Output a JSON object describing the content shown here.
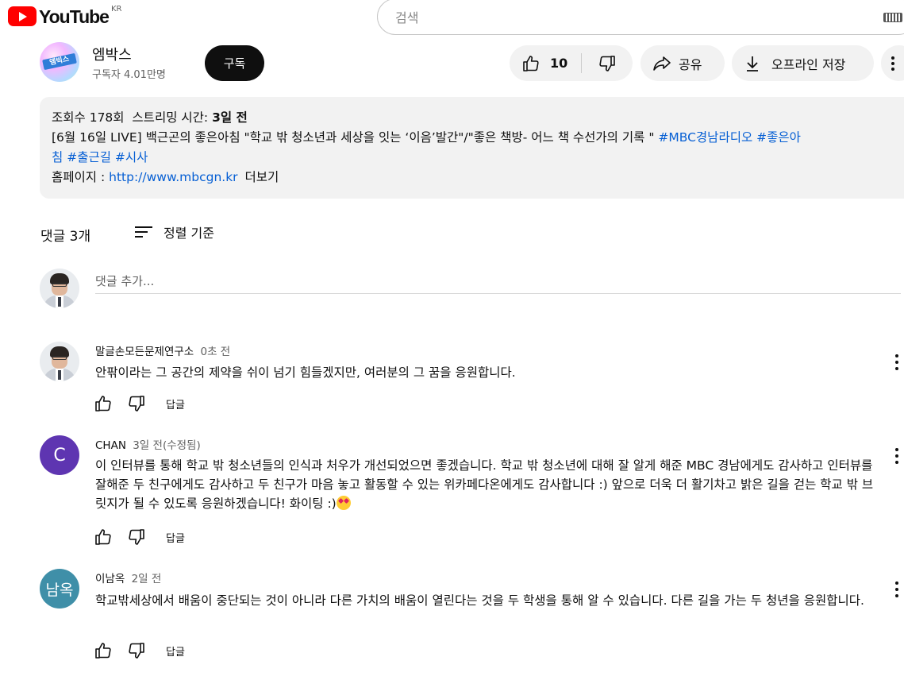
{
  "header": {
    "logo_text": "YouTube",
    "country_code": "KR",
    "search_placeholder": "검색"
  },
  "channel": {
    "avatar_text": "엠빅스",
    "name": "엠박스",
    "subscribers": "구독자 4.01만명",
    "subscribe_label": "구독"
  },
  "actions": {
    "like_count": "10",
    "share_label": "공유",
    "download_label": "오프라인 저장"
  },
  "description": {
    "views": "조회수 178회",
    "streaming_label": "스트리밍 시간:",
    "streaming_time": "3일 전",
    "line1_text": "[6월 16일 LIVE] 백근곤의 좋은아침 \"학교 밖 청소년과 세상을 잇는 ‘이음’발간\"/\"좋은 책방- 어느 책 수선가의 기록 \" ",
    "hashtag1": "#MBC경남라디오",
    "hashtag2_start": "#좋은아",
    "hashtag2_end": "침",
    "hashtag3": "#출근길",
    "hashtag4": "#시사",
    "homepage_label": "홈페이지 : ",
    "homepage_url": "http://www.mbcgn.kr",
    "more_label": "더보기"
  },
  "comments_header": {
    "count_label": "댓글 3개",
    "sort_label": "정렬 기준"
  },
  "add_comment": {
    "placeholder": "댓글 추가..."
  },
  "comments": [
    {
      "author": "말글손모든문제연구소",
      "time": "0초 전",
      "text": "안팎이라는 그 공간의 제약을 쉬이 넘기 힘들겠지만, 여러분의 그 꿈을 응원합니다.",
      "reply_label": "답글"
    },
    {
      "author": "CHAN",
      "avatar_letter": "C",
      "avatar_color": "#5e35b1",
      "time": "3일 전(수정됨)",
      "text": "이 인터뷰를 통해 학교 밖 청소년들의 인식과 처우가 개선되었으면 좋겠습니다. 학교 밖 청소년에 대해 잘 알게 해준 MBC 경남에게도 감사하고 인터뷰를 잘해준 두 친구에게도 감사하고 두 친구가 마음 놓고 활동할 수 있는 위카페다온에게도 감사합니다 :) 앞으로 더욱 더 활기차고 밝은 길을 걷는 학교 밖 브릿지가 될 수 있도록 응원하겠습니다! 화이팅 :)",
      "reply_label": "답글"
    },
    {
      "author": "이남옥",
      "avatar_letter": "남옥",
      "avatar_color": "#3f8fa8",
      "time": "2일 전",
      "text": "학교밖세상에서 배움이 중단되는 것이 아니라 다른 가치의 배움이 열린다는 것을 두 학생을 통해 알 수 있습니다. 다른 길을 가는 두 청년을 응원합니다.",
      "reply_label": "답글"
    }
  ]
}
